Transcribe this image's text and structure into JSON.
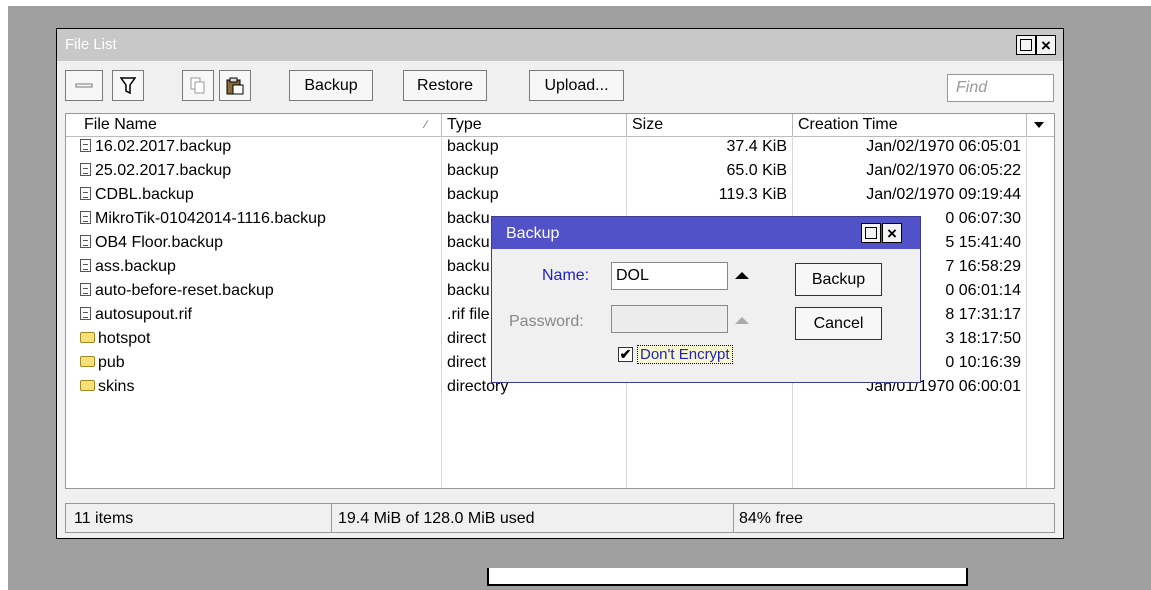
{
  "window": {
    "title": "File List"
  },
  "toolbar": {
    "backup_label": "Backup",
    "restore_label": "Restore",
    "upload_label": "Upload...",
    "find_placeholder": "Find"
  },
  "table": {
    "columns": [
      "File Name",
      "Type",
      "Size",
      "Creation Time"
    ],
    "rows": [
      {
        "name": "16.02.2017.backup",
        "type": "backup",
        "size": "37.4 KiB",
        "time": "Jan/02/1970 06:05:01",
        "icon": "file"
      },
      {
        "name": "25.02.2017.backup",
        "type": "backup",
        "size": "65.0 KiB",
        "time": "Jan/02/1970 06:05:22",
        "icon": "file"
      },
      {
        "name": "CDBL.backup",
        "type": "backup",
        "size": "119.3 KiB",
        "time": "Jan/02/1970 09:19:44",
        "icon": "file"
      },
      {
        "name": "MikroTik-01042014-1116.backup",
        "type": "backu",
        "size": "",
        "time": "0 06:07:30",
        "icon": "file"
      },
      {
        "name": "OB4 Floor.backup",
        "type": "backu",
        "size": "",
        "time": "5 15:41:40",
        "icon": "file"
      },
      {
        "name": "ass.backup",
        "type": "backu",
        "size": "",
        "time": "7 16:58:29",
        "icon": "file"
      },
      {
        "name": "auto-before-reset.backup",
        "type": "backu",
        "size": "",
        "time": "0 06:01:14",
        "icon": "file"
      },
      {
        "name": "autosupout.rif",
        "type": ".rif file",
        "size": "",
        "time": "8 17:31:17",
        "icon": "file"
      },
      {
        "name": "hotspot",
        "type": "direct",
        "size": "",
        "time": "3 18:17:50",
        "icon": "folder"
      },
      {
        "name": "pub",
        "type": "direct",
        "size": "",
        "time": "0 10:16:39",
        "icon": "folder"
      },
      {
        "name": "skins",
        "type": "directory",
        "size": "",
        "time": "Jan/01/1970 06:00:01",
        "icon": "folder"
      }
    ]
  },
  "status": {
    "items": "11 items",
    "used": "19.4 MiB of 128.0 MiB used",
    "free": "84% free"
  },
  "dialog": {
    "title": "Backup",
    "name_label": "Name:",
    "name_value": "DOL",
    "password_label": "Password:",
    "password_value": "",
    "backup_label": "Backup",
    "cancel_label": "Cancel",
    "dont_encrypt_label": "Don't Encrypt",
    "dont_encrypt_checked": true
  },
  "colors": {
    "dialog_title_bg": "#5151c8",
    "label_blue": "#2020c8",
    "window_title_bg": "#c8c8c8"
  }
}
